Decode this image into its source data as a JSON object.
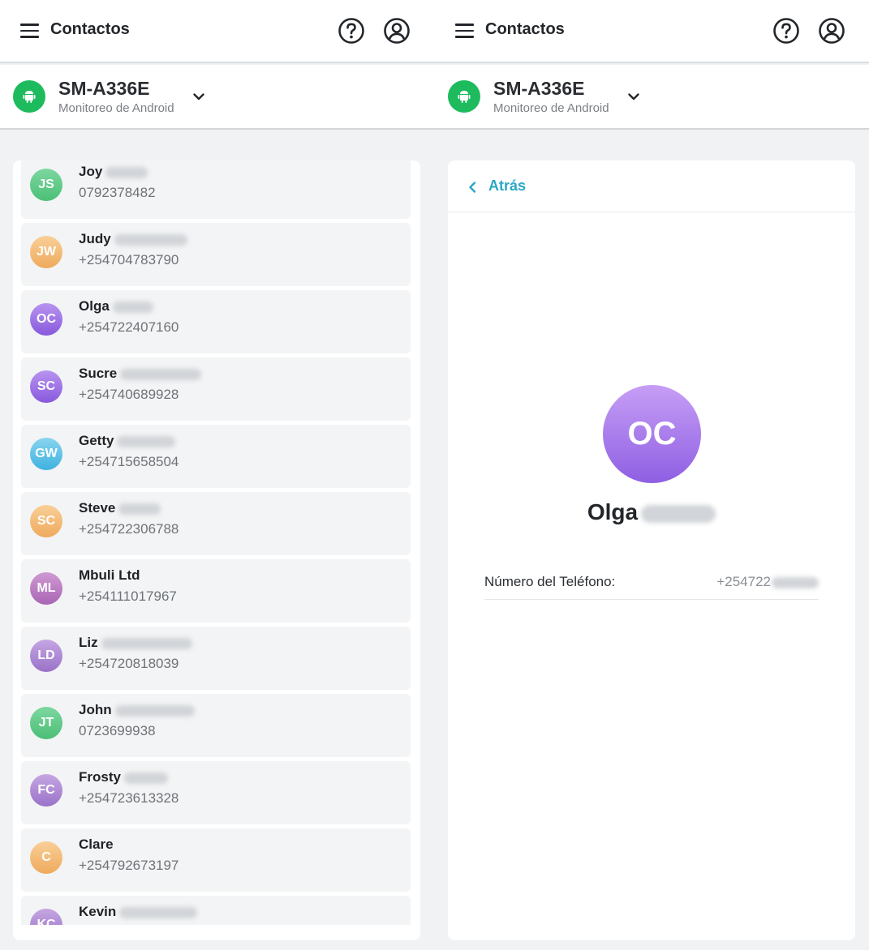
{
  "app": {
    "title": "Contactos",
    "device_name": "SM-A336E",
    "device_subtitle": "Monitoreo de Android"
  },
  "icons": {
    "menu": "hamburger-icon",
    "help": "help-icon",
    "account": "account-icon",
    "device": "android-icon",
    "dropdown": "chevron-down-icon",
    "back": "chevron-left-icon"
  },
  "colors": {
    "accent": "#2aa7c7",
    "device_badge": "#1dbb5e"
  },
  "contacts": [
    {
      "initials": "JS",
      "name": "Joy",
      "phone": "0792378482"
    },
    {
      "initials": "JW",
      "name": "Judy",
      "phone": "+254704783790"
    },
    {
      "initials": "OC",
      "name": "Olga",
      "phone": "+254722407160"
    },
    {
      "initials": "SC",
      "name": "Sucre",
      "phone": "+254740689928"
    },
    {
      "initials": "GW",
      "name": "Getty",
      "phone": "+254715658504"
    },
    {
      "initials": "SC",
      "name": "Steve",
      "phone": "+254722306788"
    },
    {
      "initials": "ML",
      "name": "Mbuli Ltd",
      "phone": "+254111017967"
    },
    {
      "initials": "LD",
      "name": "Liz",
      "phone": "+254720818039"
    },
    {
      "initials": "JT",
      "name": "John",
      "phone": "0723699938"
    },
    {
      "initials": "FC",
      "name": "Frosty",
      "phone": "+254723613328"
    },
    {
      "initials": "C",
      "name": "Clare",
      "phone": "+254792673197"
    },
    {
      "initials": "KC",
      "name": "Kevin",
      "phone": ""
    }
  ],
  "detail": {
    "back_label": "Atrás",
    "initials": "OC",
    "name": "Olga",
    "phone_label": "Número del Teléfono:",
    "phone_value": "+254722"
  }
}
